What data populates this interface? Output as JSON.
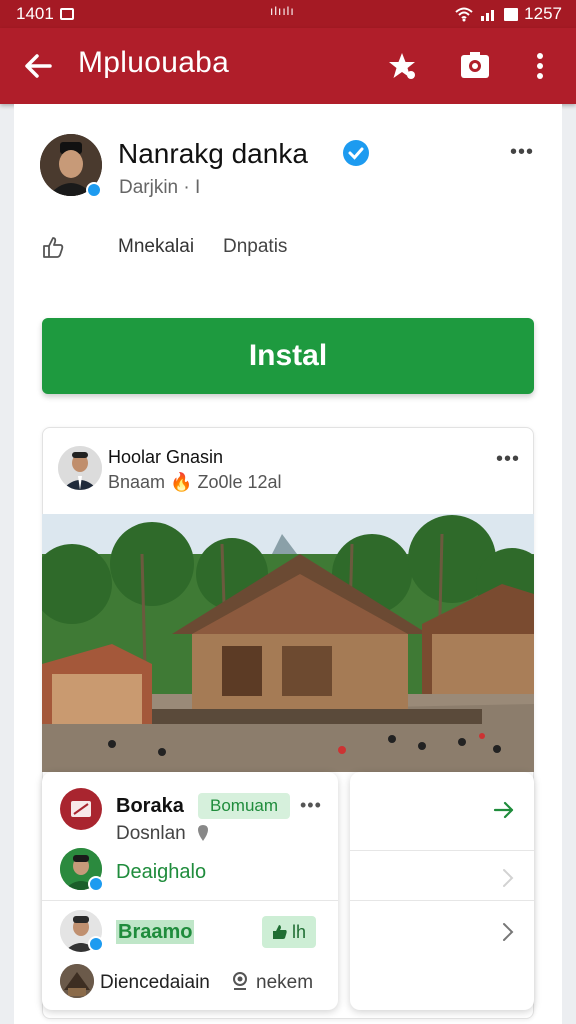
{
  "status_bar": {
    "time": "1401",
    "center": "ılıılı",
    "right": "1257"
  },
  "app_bar": {
    "title": "Mpluouaba",
    "icons": [
      "back-arrow-icon",
      "star-bookmark-icon",
      "camera-icon",
      "more-vert-icon"
    ]
  },
  "profile": {
    "name": "Nanrakg danka",
    "subtitle": "Darjkin · I",
    "verified": true,
    "tabs": [
      "Mnekalai",
      "Dnpatis"
    ]
  },
  "install_label": "Instal",
  "post": {
    "author": "Hoolar Gnasin",
    "meta": "Bnaam 🔥 Zo0le 12al",
    "image_alt": "traditional wooden house among palm trees with people"
  },
  "comments": {
    "row1_title": "Boraka",
    "row1_badge": "Bomuam",
    "row1_sub": "Dosnlan",
    "row2_label": "Deaighalo",
    "row3_label": "Braamo",
    "row3_chip": "lh",
    "row4_label": "Diencedaiain",
    "row4_extra": "nekem"
  },
  "colors": {
    "brand": "#b01e2a",
    "install": "#1e9a3f",
    "verified": "#1d9bf0",
    "badge_bg": "#d6f0dc",
    "badge_text": "#1f8c3c"
  }
}
